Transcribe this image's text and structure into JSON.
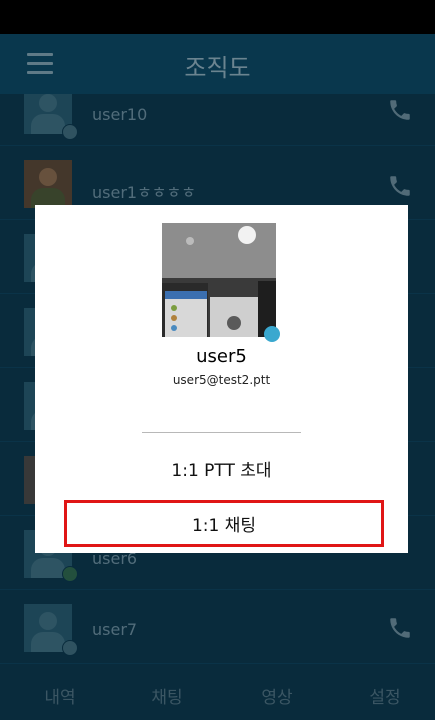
{
  "header": {
    "title": "조직도"
  },
  "contacts": [
    {
      "name": "user10"
    },
    {
      "name": "user1ㅎㅎㅎㅎ"
    },
    {
      "name": ""
    },
    {
      "name": ""
    },
    {
      "name": ""
    },
    {
      "name": ""
    },
    {
      "name": "user6"
    },
    {
      "name": "user7"
    }
  ],
  "tabs": [
    "내역",
    "채팅",
    "영상",
    "설정"
  ],
  "dialog": {
    "name": "user5",
    "email": "user5@test2.ptt",
    "ptt_label": "1:1 PTT 초대",
    "chat_label": "1:1 채팅"
  },
  "colors": {
    "online": "#3aa8cf",
    "highlight": "#e01515",
    "appbar": "#0d4a67"
  },
  "icons": [
    "menu-icon",
    "phone-icon",
    "user-avatar-icon"
  ]
}
